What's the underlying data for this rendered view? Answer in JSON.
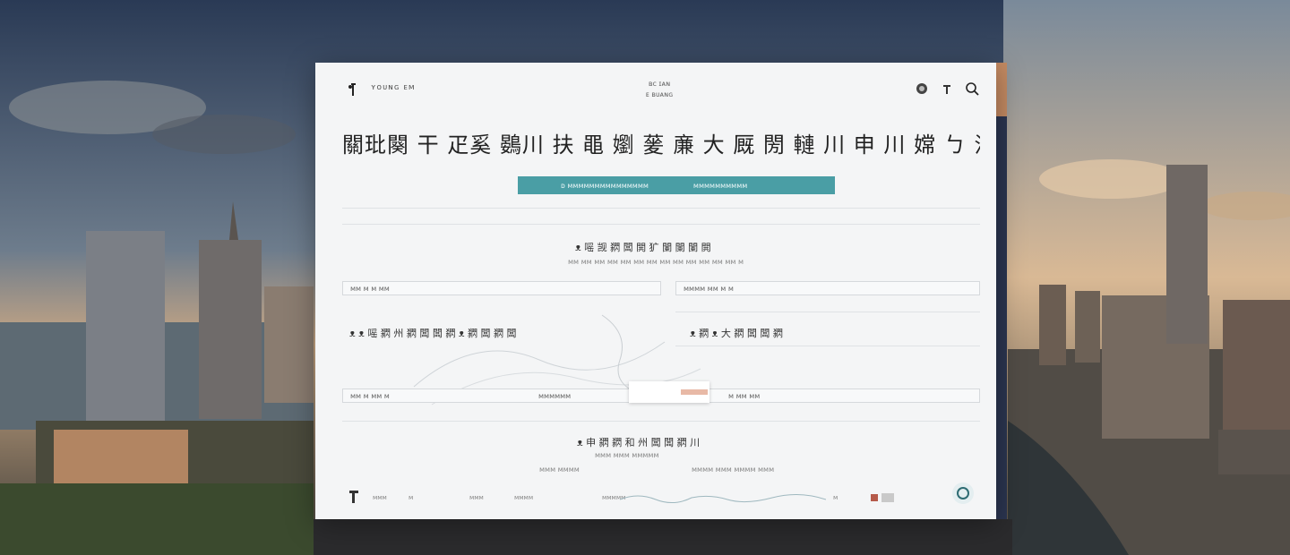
{
  "brand": {
    "name": "ʏᴏᴜɴɢ ᴇᴍ"
  },
  "top_center": {
    "line1": "ʙᴄ ɪᴀɴ",
    "line2": "ᴇ ʙᴜᴀɴɢ"
  },
  "icons": [
    "logo-figure-icon",
    "badge-icon",
    "figure-icon",
    "search-icon",
    "chat-icon"
  ],
  "headline": "關玭闋 干 疋奚 鷃川 扶 黽 嬼 蓌 亷 大 厩 閍 轋 川 申 川 嫦 ㄅ 汅 御 闍 轛  鐃",
  "tabs": {
    "first": "ᴅ   ᴍᴍᴍᴍᴍᴍᴍᴍᴍᴍᴍᴍᴍᴍᴍ",
    "second": "ᴍᴍᴍᴍᴍᴍᴍᴍᴍᴍ"
  },
  "section1": {
    "title": "ᴥ 嗂 觊 閷 闆 閧 犷 闌 闌 闌 閧",
    "subtitle": "ᴍᴍ ᴍᴍ ᴍᴍ ᴍᴍ ᴍᴍ ᴍᴍ ᴍᴍ ᴍᴍ ᴍᴍ ᴍᴍ ᴍᴍ ᴍᴍ ᴍᴍ ᴍ",
    "field_left": "ᴍᴍ ᴍ ᴍ ᴍᴍ",
    "field_right": "ᴍᴍᴍᴍ ᴍᴍ ᴍ ᴍ"
  },
  "section2": {
    "left_title": "ᴥ ᴥ 嗂 閷 州 閷 闆 闆 閷 ᴥ 閷 闆 閷 闆",
    "right_title": "ᴥ 閷 ᴥ 大 閷 闆 闆 閷",
    "field_left": "ᴍᴍ ᴍ ᴍᴍ ᴍ",
    "field_mid": "ᴍᴍᴍᴍᴍᴍ",
    "field_right": "ᴍ ᴍᴍ ᴍᴍ"
  },
  "section3": {
    "title": "ᴥ 申 閷 閷 和 州 闆 闆 閷 川",
    "subtitle_left": "ᴍᴍᴍ ᴍᴍᴍᴍ",
    "subtitle_mid": "ᴍᴍᴍ ᴍᴍᴍ ᴍᴍᴍᴍᴍ",
    "subtitle_right": "ᴍᴍᴍᴍ ᴍᴍᴍ ᴍᴍᴍᴍ ᴍᴍᴍ"
  },
  "footer": {
    "items": [
      "ᴍᴍᴍ",
      "ᴍ",
      "ᴍᴍᴍ",
      "ᴍᴍᴍᴍ",
      "ᴍᴍᴍᴍᴍ",
      "ᴍ"
    ]
  },
  "colors": {
    "accent": "#4a9ea5",
    "panel": "#f4f5f6",
    "edge": "#c48a62"
  }
}
